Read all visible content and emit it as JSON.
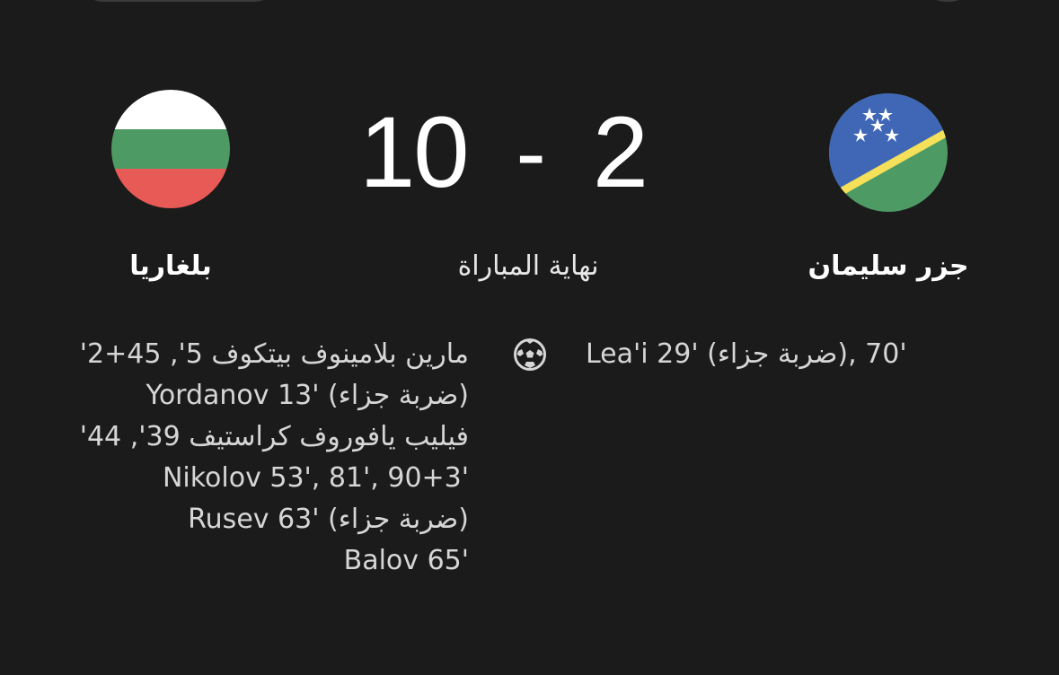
{
  "match": {
    "home_score": "10",
    "separator": "-",
    "away_score": "2",
    "status": "نهاية المباراة"
  },
  "home_team": {
    "name": "بلغاريا",
    "flag_icon": "bulgaria-flag-icon",
    "flag_colors": [
      "#ffffff",
      "#4e9a64",
      "#e85a56"
    ],
    "scorers": [
      "مارين بلامينوف بيتكوف 5', 45+2'",
      "Yordanov 13' (ضربة جزاء)",
      "فيليب يافوروف كراستيف 39', 44'",
      "Nikolov 53', 81', 90+3'",
      "Rusev 63' (ضربة جزاء)",
      "Balov 65'"
    ]
  },
  "away_team": {
    "name": "جزر سليمان",
    "flag_icon": "solomon-islands-flag-icon",
    "flag_colors": [
      "#3f67b6",
      "#4e9a64",
      "#f5e05a",
      "#ffffff"
    ],
    "scorers": [
      "Lea'i 29' (ضربة جزاء), 70'"
    ]
  },
  "goal_icon": "soccer-ball-icon",
  "colors": {
    "background": "#1b1b1b",
    "text_primary": "#ffffff",
    "text_secondary": "#d6d6d6"
  }
}
